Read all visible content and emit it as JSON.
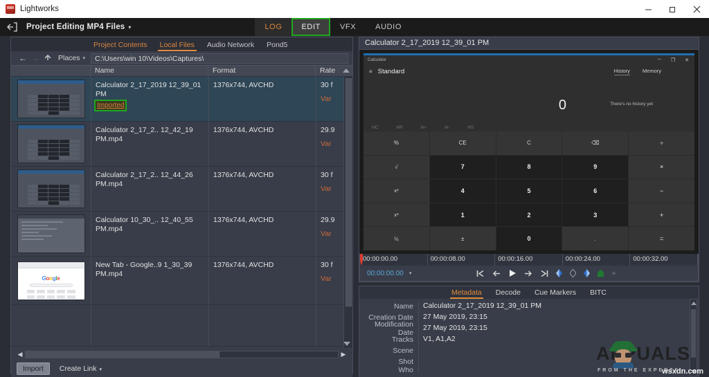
{
  "window": {
    "app_title": "Lightworks",
    "app_icon": "lightworks-icon",
    "minimize": "─",
    "maximize": "❐",
    "close": "✕"
  },
  "appbar": {
    "exit_icon": "exit-project-icon",
    "project_title": "Project Editing MP4 Files",
    "project_caret": "▾",
    "mode_tabs": [
      {
        "label": "LOG",
        "name": "tab-log",
        "state": "inactive"
      },
      {
        "label": "EDIT",
        "name": "tab-edit",
        "state": "highlighted"
      },
      {
        "label": "VFX",
        "name": "tab-vfx",
        "state": "inactive"
      },
      {
        "label": "AUDIO",
        "name": "tab-audio",
        "state": "inactive"
      }
    ]
  },
  "browser": {
    "tabs": [
      {
        "label": "Project Contents",
        "name": "tab-project-contents"
      },
      {
        "label": "Local Files",
        "name": "tab-local-files"
      },
      {
        "label": "Audio Network",
        "name": "tab-audio-network"
      },
      {
        "label": "Pond5",
        "name": "tab-pond5"
      }
    ],
    "nav": {
      "back_icon": "←",
      "forward_icon": "→",
      "up_icon": "⬆",
      "places_label": "Places",
      "places_caret": "▾",
      "path_value": "C:\\Users\\win 10\\Videos\\Captures\\"
    },
    "columns": [
      {
        "label": "",
        "name": "column-thumbnail"
      },
      {
        "label": "Name",
        "name": "column-name"
      },
      {
        "label": "Format",
        "name": "column-format"
      },
      {
        "label": "Rate",
        "name": "column-rate"
      }
    ],
    "rows": [
      {
        "name": "Calculator 2_17_2019 12_39_01 PM",
        "badge": "Imported",
        "format": "1376x744, AVCHD",
        "rate": "30 f",
        "rate_var": "Var",
        "thumb": "calculator",
        "selected": true
      },
      {
        "name": "Calculator 2_17_2.. 12_42_19 PM.mp4",
        "badge": "",
        "format": "1376x744, AVCHD",
        "rate": "29.9",
        "rate_var": "Var",
        "thumb": "calculator",
        "selected": false
      },
      {
        "name": "Calculator 2_17_2.. 12_44_26 PM.mp4",
        "badge": "",
        "format": "1376x744, AVCHD",
        "rate": "30 f",
        "rate_var": "Var",
        "thumb": "calculator",
        "selected": false
      },
      {
        "name": "Calculator 10_30_.. 12_40_55 PM.mp4",
        "badge": "",
        "format": "1376x744, AVCHD",
        "rate": "29.9",
        "rate_var": "Var",
        "thumb": "document",
        "selected": false
      },
      {
        "name": "New Tab - Google..9 1_30_39 PM.mp4",
        "badge": "",
        "format": "1376x744, AVCHD",
        "rate": "30 f",
        "rate_var": "Var",
        "thumb": "google",
        "selected": false
      }
    ],
    "scroll_up_icon": "scroll-up-arrow-icon",
    "scroll_down_icon": "scroll-down-arrow-icon",
    "hscroll_left_icon": "◀",
    "hscroll_right_icon": "▶",
    "import_button": "Import",
    "create_link": "Create Link",
    "create_link_caret": "▾"
  },
  "viewer": {
    "title": "Calculator 2_17_2019 12_39_01 PM",
    "preview": {
      "window_name": "Calculator",
      "minimize": "─",
      "maximize": "❐",
      "close": "✕",
      "hamburger": "≡",
      "mode": "Standard",
      "history_tab": "History",
      "memory_tab": "Memory",
      "display_value": "0",
      "history_empty": "There's no history yet",
      "memory_row": [
        "MC",
        "MR",
        "M+",
        "M-",
        "MS"
      ],
      "keys": [
        {
          "label": "%",
          "kind": "fn"
        },
        {
          "label": "CE",
          "kind": "fn"
        },
        {
          "label": "C",
          "kind": "fn"
        },
        {
          "label": "⌫",
          "kind": "fn"
        },
        {
          "label": "÷",
          "kind": "op"
        },
        {
          "label": "√",
          "kind": "fn"
        },
        {
          "label": "7",
          "kind": "num"
        },
        {
          "label": "8",
          "kind": "num"
        },
        {
          "label": "9",
          "kind": "num"
        },
        {
          "label": "×",
          "kind": "op"
        },
        {
          "label": "x²",
          "kind": "fn"
        },
        {
          "label": "4",
          "kind": "num"
        },
        {
          "label": "5",
          "kind": "num"
        },
        {
          "label": "6",
          "kind": "num"
        },
        {
          "label": "−",
          "kind": "op"
        },
        {
          "label": "x³",
          "kind": "fn"
        },
        {
          "label": "1",
          "kind": "num"
        },
        {
          "label": "2",
          "kind": "num"
        },
        {
          "label": "3",
          "kind": "num"
        },
        {
          "label": "+",
          "kind": "op"
        },
        {
          "label": "⅟ₓ",
          "kind": "fn"
        },
        {
          "label": "±",
          "kind": "fn"
        },
        {
          "label": "0",
          "kind": "num"
        },
        {
          "label": ".",
          "kind": "fn"
        },
        {
          "label": "=",
          "kind": "op"
        }
      ]
    }
  },
  "timeline": {
    "ticks": [
      "00:00:00.00",
      "00:00:08.00",
      "00:00:16.00",
      "00:00:24.00",
      "00:00:32.00"
    ],
    "current_time": "00:00:00.00",
    "time_caret": "▾",
    "controls": [
      {
        "icon": "⇤",
        "name": "go-to-start-button"
      },
      {
        "icon": "←",
        "name": "step-back-button"
      },
      {
        "icon": "▶",
        "name": "play-button"
      },
      {
        "icon": "→",
        "name": "step-forward-button"
      },
      {
        "icon": "⇥",
        "name": "go-to-end-button"
      }
    ],
    "mark_in": "mark-in-icon",
    "mark_clear": "mark-clear-icon",
    "mark_out": "mark-out-icon",
    "add_cue": "add-cue-icon",
    "plus": "+"
  },
  "metadata": {
    "tabs": [
      {
        "label": "Metadata",
        "name": "tab-metadata"
      },
      {
        "label": "Decode",
        "name": "tab-decode"
      },
      {
        "label": "Cue Markers",
        "name": "tab-cue-markers"
      },
      {
        "label": "BITC",
        "name": "tab-bitc"
      }
    ],
    "fields": [
      {
        "label": "Name",
        "value": "Calculator 2_17_2019 12_39_01 PM"
      },
      {
        "label": "Creation Date",
        "value": "27 May 2019, 23:15"
      },
      {
        "label": "Modification Date",
        "value": "27 May 2019, 23:15"
      },
      {
        "label": "Tracks",
        "value": "V1, A1,A2"
      },
      {
        "label": "Scene",
        "value": ""
      },
      {
        "label": "Shot",
        "value": ""
      },
      {
        "label": "Who",
        "value": ""
      }
    ]
  },
  "watermark": {
    "text": "APPUALS",
    "subtitle": "FROM THE EXPERTS",
    "source": "wsxdn.com"
  },
  "colors": {
    "accent_orange": "#e08a3c",
    "highlight_green": "#1fa81f",
    "selected_row": "#2e4656",
    "panel_bg": "#383d49",
    "timecode_blue": "#5fa8d8"
  }
}
